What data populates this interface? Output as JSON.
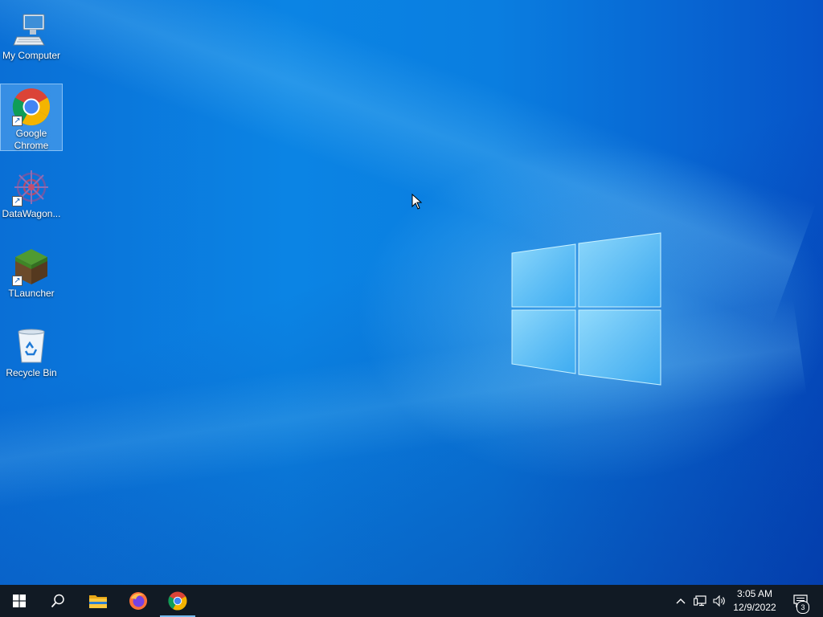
{
  "desktop": {
    "icons": [
      {
        "label": "My Computer",
        "icon": "computer-icon",
        "shortcut": false,
        "selected": false
      },
      {
        "label": "Google\nChrome",
        "icon": "chrome-icon",
        "shortcut": true,
        "selected": true
      },
      {
        "label": "DataWagon...",
        "icon": "datawagon-icon",
        "shortcut": true,
        "selected": false
      },
      {
        "label": "TLauncher",
        "icon": "tlauncher-icon",
        "shortcut": true,
        "selected": false
      },
      {
        "label": "Recycle Bin",
        "icon": "recycle-bin-icon",
        "shortcut": false,
        "selected": false
      }
    ]
  },
  "taskbar": {
    "pinned": [
      {
        "name": "start",
        "icon": "windows-start-icon"
      },
      {
        "name": "search",
        "icon": "search-icon"
      },
      {
        "name": "file-explorer",
        "icon": "folder-icon"
      },
      {
        "name": "firefox",
        "icon": "firefox-icon"
      },
      {
        "name": "chrome",
        "icon": "chrome-icon",
        "active": true
      }
    ],
    "tray": {
      "icons": [
        "chevron-up-icon",
        "network-icon",
        "volume-icon"
      ],
      "time": "3:05 AM",
      "date": "12/9/2022",
      "notifications_count": "3"
    }
  },
  "colors": {
    "taskbar": "#111a24",
    "desktop_accent": "#0a7ee0",
    "active_indicator": "#76b9ed"
  }
}
